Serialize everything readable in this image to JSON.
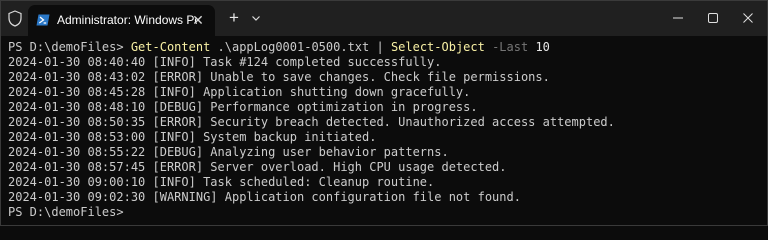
{
  "window": {
    "tab_title": "Administrator: Windows PowerShell",
    "tab_close_glyph": "✕",
    "new_tab_glyph": "+",
    "icons": [
      "shield-icon",
      "powershell-icon",
      "close-icon",
      "plus-icon",
      "chevron-down-icon",
      "minimize-icon",
      "maximize-icon",
      "close-window-icon"
    ]
  },
  "terminal": {
    "command": {
      "prompt": "PS D:\\demoFiles> ",
      "cmdlet1": "Get-Content",
      "arg": " .\\appLog0001-0500.txt ",
      "pipe": "| ",
      "cmdlet2": "Select-Object",
      "param": " -Last ",
      "value": "10"
    },
    "output": [
      "2024-01-30 08:40:40 [INFO] Task #124 completed successfully.",
      "2024-01-30 08:43:02 [ERROR] Unable to save changes. Check file permissions.",
      "2024-01-30 08:45:28 [INFO] Application shutting down gracefully.",
      "2024-01-30 08:48:10 [DEBUG] Performance optimization in progress.",
      "2024-01-30 08:50:35 [ERROR] Security breach detected. Unauthorized access attempted.",
      "2024-01-30 08:53:00 [INFO] System backup initiated.",
      "2024-01-30 08:55:22 [DEBUG] Analyzing user behavior patterns.",
      "2024-01-30 08:57:45 [ERROR] Server overload. High CPU usage detected.",
      "2024-01-30 09:00:10 [INFO] Task scheduled: Cleanup routine.",
      "2024-01-30 09:02:30 [WARNING] Application configuration file not found."
    ],
    "final_prompt": "PS D:\\demoFiles>"
  },
  "colors": {
    "background": "#0c0c0c",
    "titlebar": "#202020",
    "text": "#cccccc",
    "cmdlet": "#f9f1a5",
    "parameter": "#767676",
    "powershell_blue": "#2a78c8"
  }
}
